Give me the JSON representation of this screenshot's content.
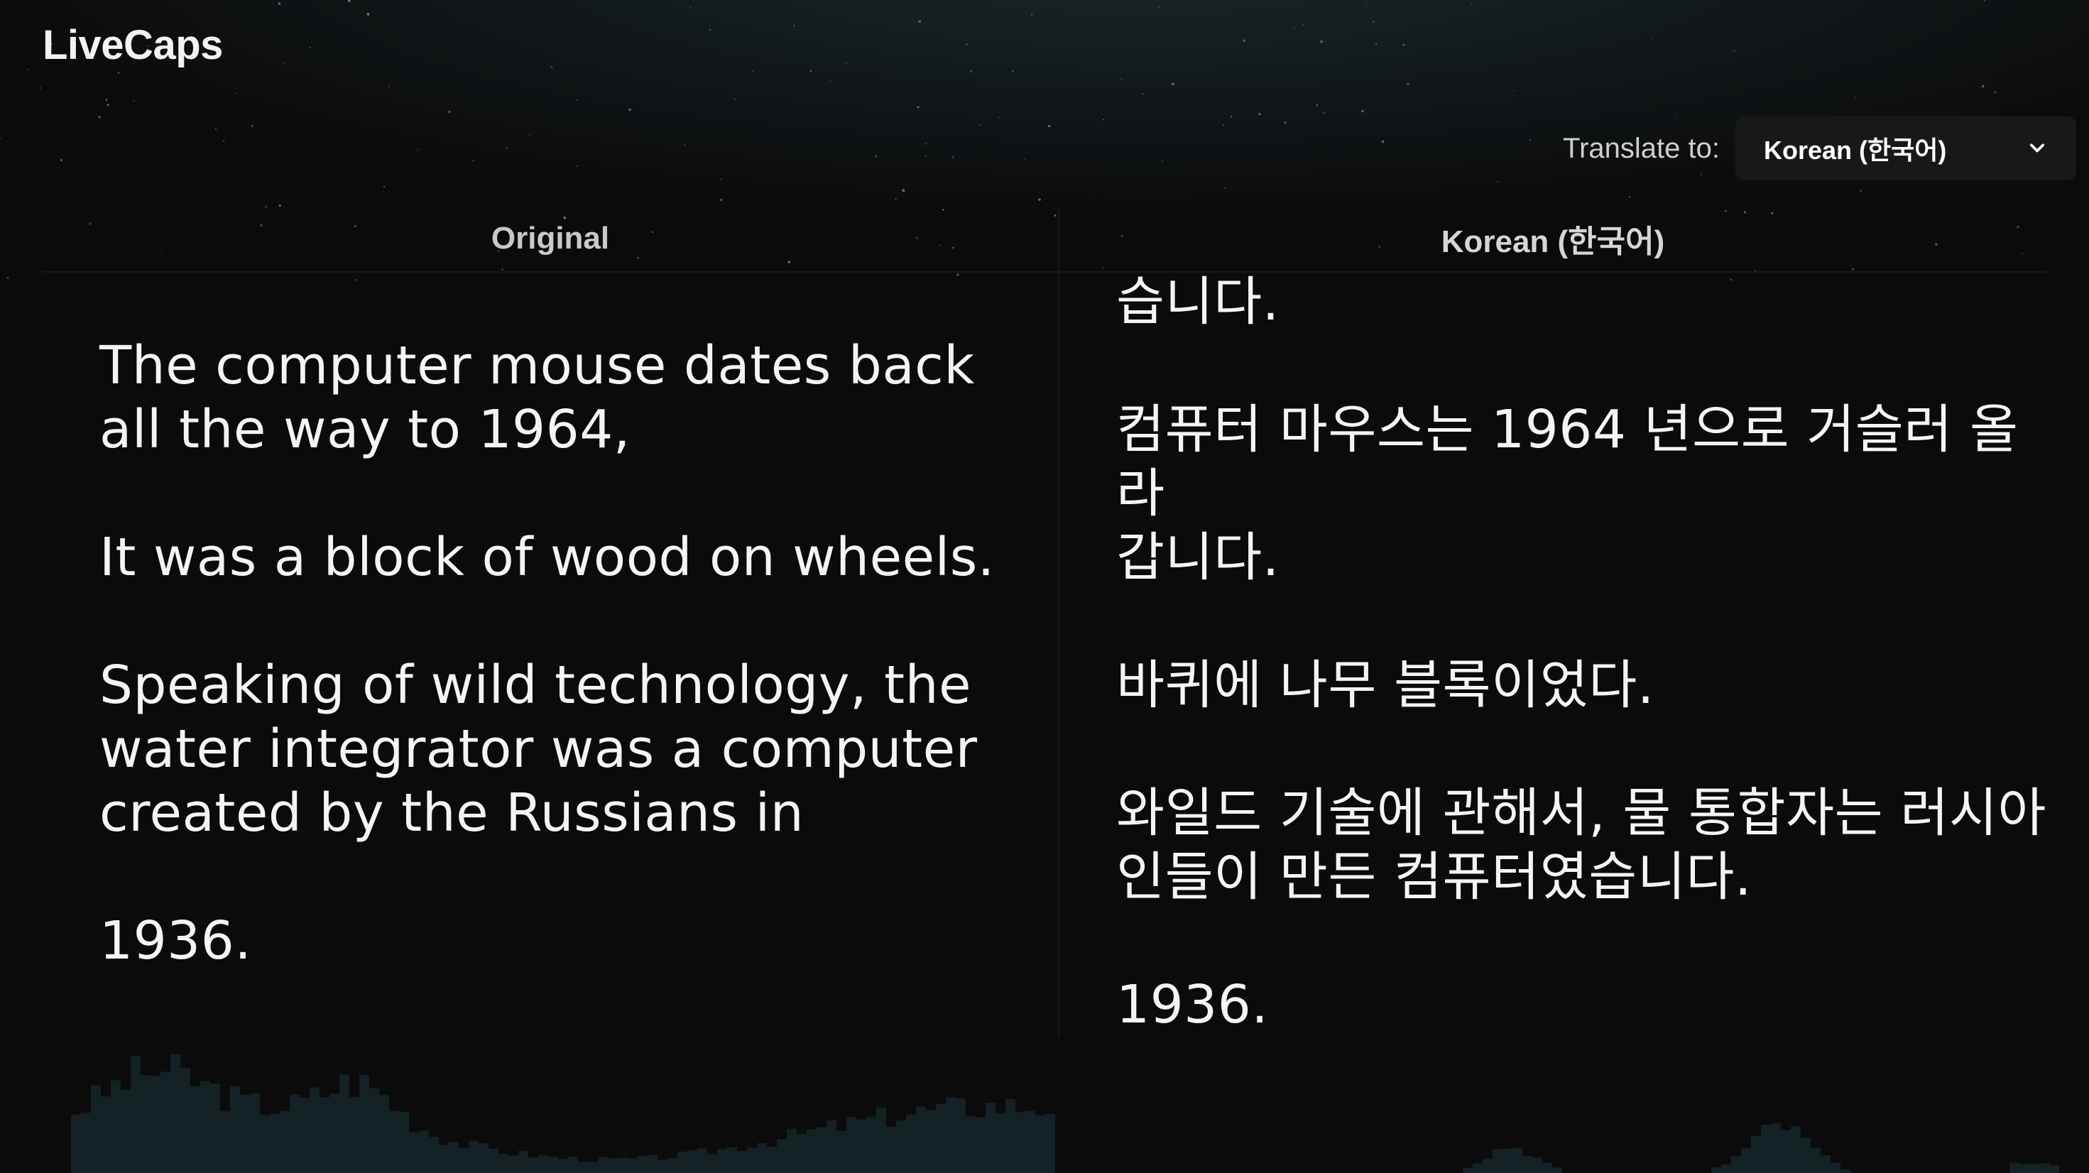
{
  "app": {
    "title": "LiveCaps"
  },
  "translate": {
    "label": "Translate to:",
    "selected_language": "Korean (한국어)"
  },
  "columns": {
    "original": {
      "header": "Original",
      "paragraphs": [
        "The computer mouse dates back\nall the way to 1964,",
        "It was a block of wood on wheels.",
        "Speaking of wild technology, the\nwater integrator was a computer\ncreated by the Russians in",
        "1936."
      ]
    },
    "translated": {
      "header": "Korean (한국어)",
      "paragraphs": [
        "습니다.",
        "컴퓨터 마우스는 1964 년으로 거슬러 올라\n갑니다.",
        "바퀴에 나무 블록이었다.",
        "와일드 기술에 관해서, 물 통합자는 러시아\n인들이 만든 컴퓨터였습니다.",
        "1936."
      ]
    }
  },
  "colors": {
    "background": "#0b0b0c",
    "panel": "#17181a",
    "waveform": "#16262a"
  },
  "icons": {
    "dropdown": "chevron-down-icon"
  }
}
